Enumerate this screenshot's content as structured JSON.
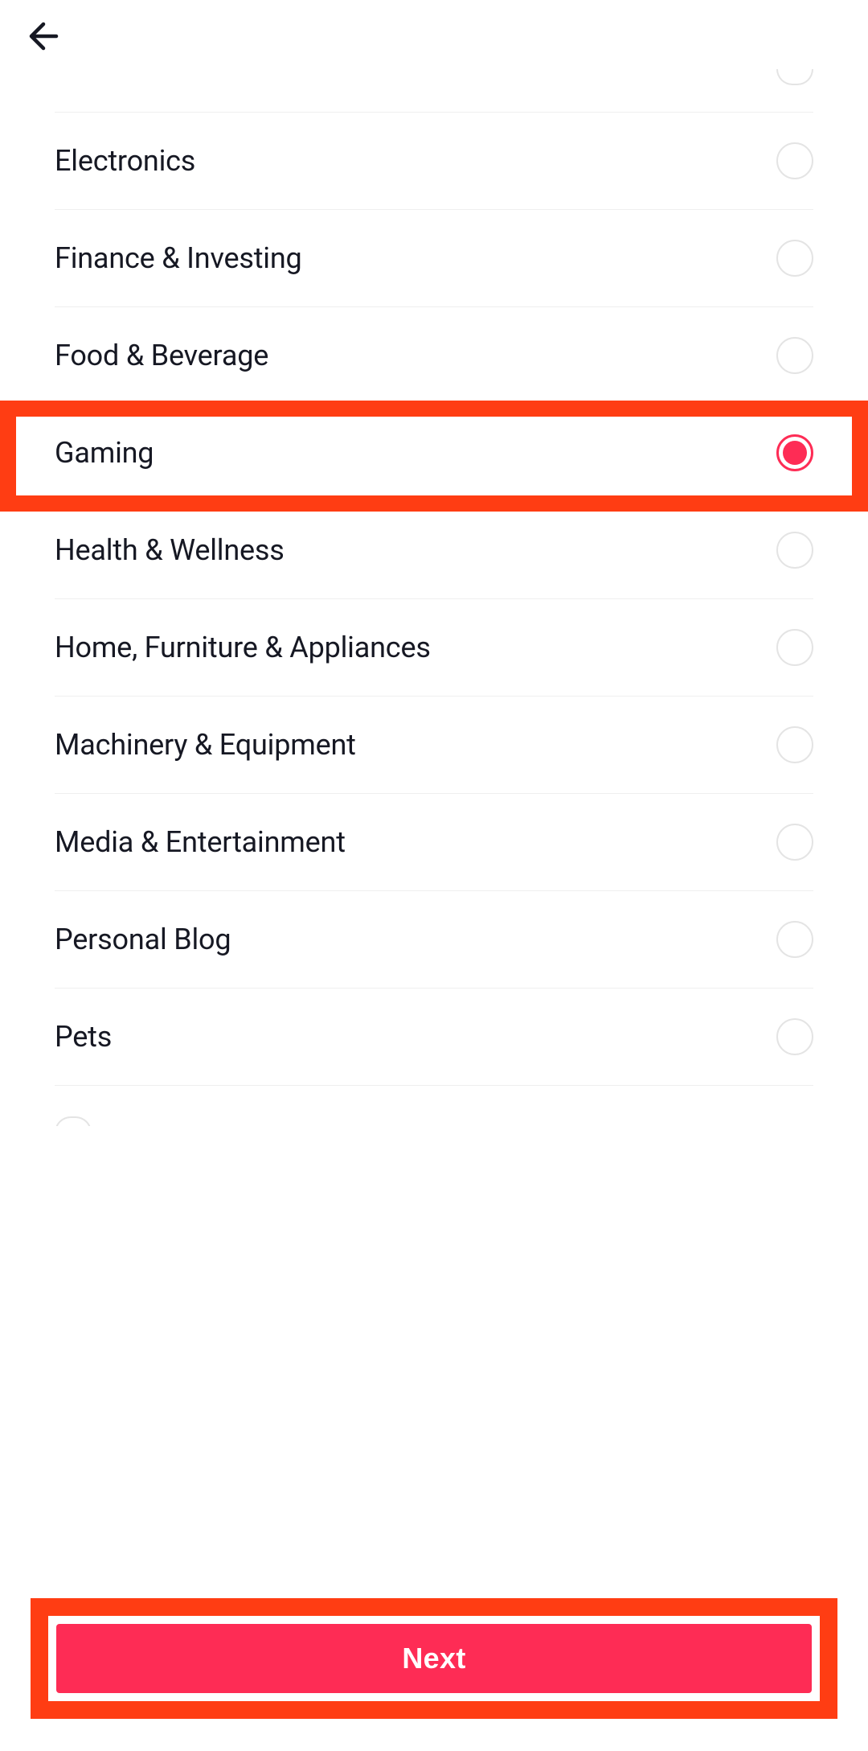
{
  "categories": [
    {
      "label": "Electronics",
      "selected": false,
      "id": "electronics"
    },
    {
      "label": "Finance & Investing",
      "selected": false,
      "id": "finance-investing"
    },
    {
      "label": "Food & Beverage",
      "selected": false,
      "id": "food-beverage"
    },
    {
      "label": "Gaming",
      "selected": true,
      "id": "gaming",
      "highlighted": true
    },
    {
      "label": "Health & Wellness",
      "selected": false,
      "id": "health-wellness"
    },
    {
      "label": "Home, Furniture & Appliances",
      "selected": false,
      "id": "home-furniture-appliances"
    },
    {
      "label": "Machinery & Equipment",
      "selected": false,
      "id": "machinery-equipment"
    },
    {
      "label": "Media & Entertainment",
      "selected": false,
      "id": "media-entertainment"
    },
    {
      "label": "Personal Blog",
      "selected": false,
      "id": "personal-blog"
    },
    {
      "label": "Pets",
      "selected": false,
      "id": "pets"
    }
  ],
  "footer": {
    "next_label": "Next"
  }
}
